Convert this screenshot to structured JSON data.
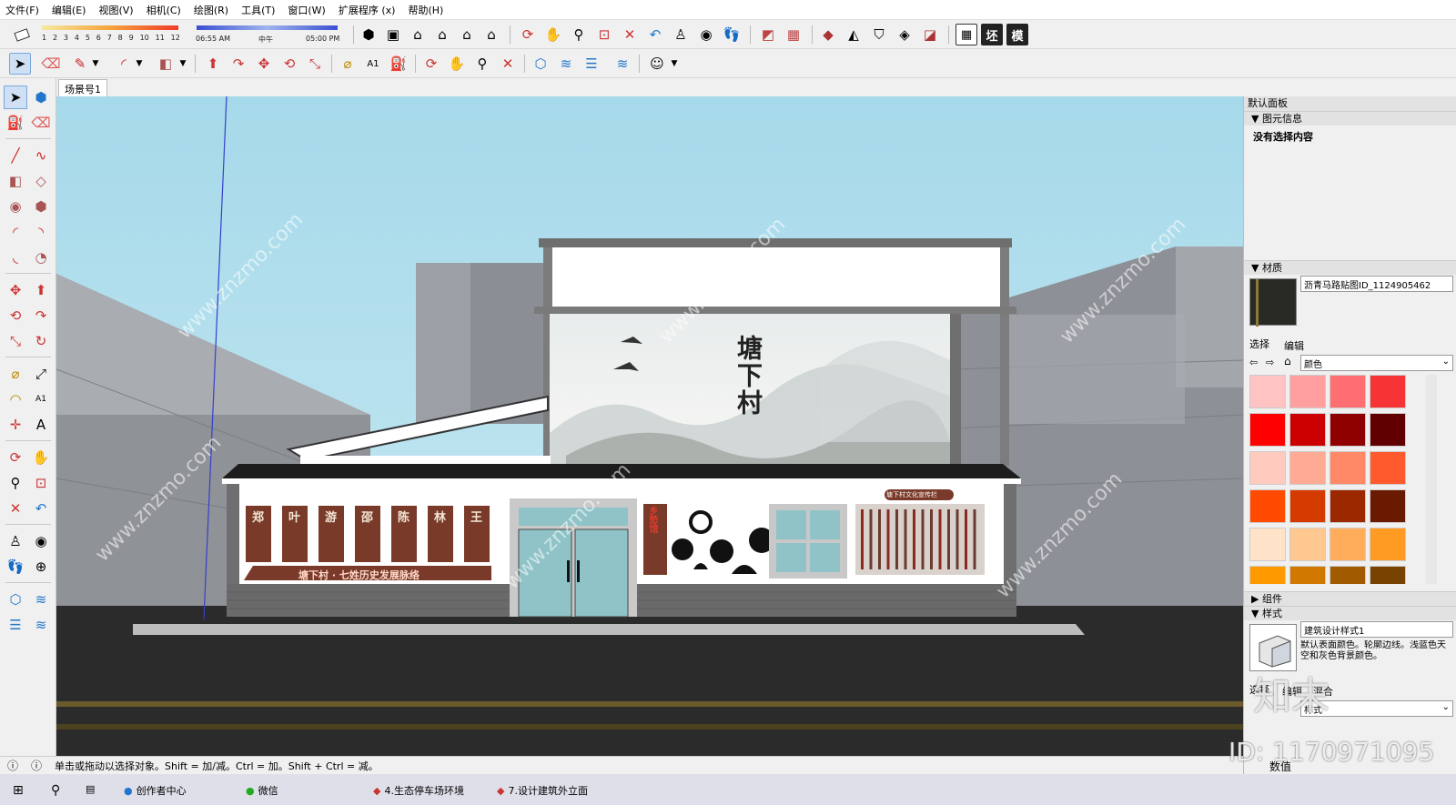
{
  "menu": [
    "文件(F)",
    "编辑(E)",
    "视图(V)",
    "相机(C)",
    "绘图(R)",
    "工具(T)",
    "窗口(W)",
    "扩展程序 (x)",
    "帮助(H)"
  ],
  "shadow": {
    "months": [
      "1",
      "2",
      "3",
      "4",
      "5",
      "6",
      "7",
      "8",
      "9",
      "10",
      "11",
      "12"
    ],
    "time_start": "06:55 AM",
    "time_mid": "中午",
    "time_end": "05:00 PM"
  },
  "toolbar_text_buttons": [
    "坯",
    "模"
  ],
  "scene_tab": "场景号1",
  "scene": {
    "village_title": "塘下村",
    "banner": "塘下村 · 七姓历史发展脉络",
    "surnames": [
      "郑",
      "叶",
      "游",
      "邵",
      "陈",
      "林",
      "王"
    ],
    "sign_small": "塘下村文化宣传栏",
    "vertical_sign": "乡愁馆"
  },
  "right_panel": {
    "title": "默认面板",
    "entity_info_header": "图元信息",
    "no_selection": "没有选择内容",
    "materials_header": "材质",
    "material_name": "沥青马路贴图ID_1124905462",
    "tab_select": "选择",
    "tab_edit": "编辑",
    "dropdown": "颜色",
    "swatches": [
      "#ffc3c3",
      "#ff9fa0",
      "#ff6f72",
      "#f63335",
      "#ff0000",
      "#cc0000",
      "#8f0000",
      "#600000",
      "#ffcbbf",
      "#ffaa94",
      "#ff8866",
      "#ff5a2e",
      "#ff4a00",
      "#d53a00",
      "#9c2800",
      "#6a1a00",
      "#ffe3c8",
      "#ffc890",
      "#ffad5a",
      "#ff9a22",
      "#ff9900",
      "#d07800",
      "#a05a00",
      "#784200"
    ],
    "components_header": "组件",
    "styles_header": "样式",
    "style_name": "建筑设计样式1",
    "style_desc": "默认表面颜色。轮廓边线。浅蓝色天空和灰色背景颜色。",
    "style_tabs": [
      "选择",
      "编辑",
      "混合"
    ],
    "style_dropdown": "样式"
  },
  "status_text": "单击或拖动以选择对象。Shift = 加/减。Ctrl = 加。Shift + Ctrl = 减。",
  "value_label": "数值",
  "taskbar": [
    "创作者中心",
    "微信",
    "4.生态停车场环境",
    "7.设计建筑外立面"
  ],
  "watermark_text": "www.znzmo.com",
  "id_text": "ID: 1170971095",
  "brand_text": "知末",
  "colors": {
    "sky": "#a9dcec",
    "road": "#2b2b2b",
    "building_grey": "#9a9da2",
    "roof": "#1d1d1d",
    "wood": "#7a3a2a",
    "glass": "#8fc3c8"
  }
}
